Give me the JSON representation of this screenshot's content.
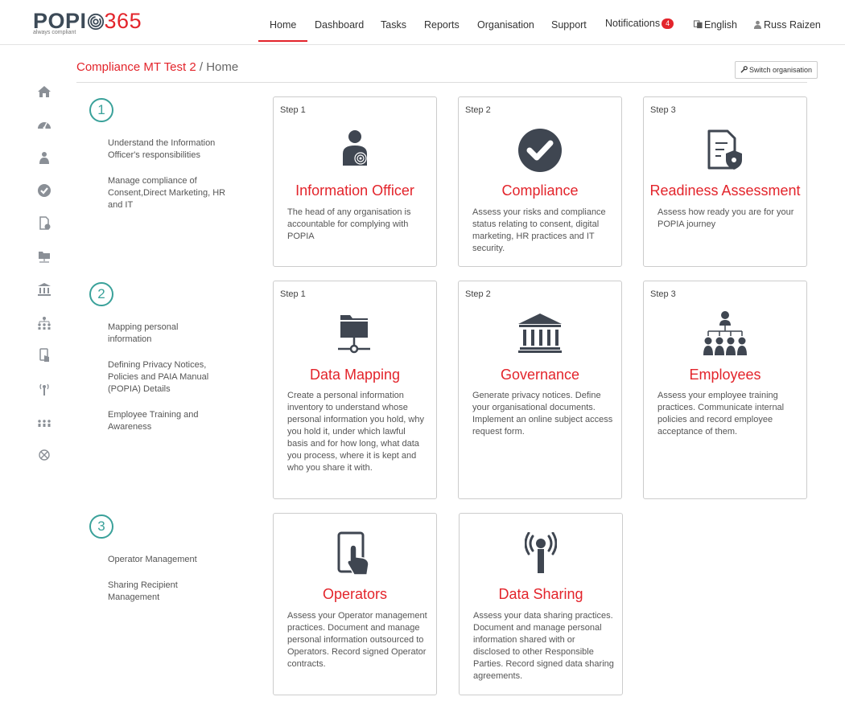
{
  "header": {
    "logo_text": "POPI",
    "logo_number": "365",
    "logo_tagline": "always compliant",
    "nav": {
      "home": "Home",
      "dashboard": "Dashboard",
      "tasks": "Tasks",
      "reports": "Reports",
      "organisation": "Organisation",
      "support": "Support",
      "notifications": "Notifications",
      "notifications_count": "4",
      "language": "English",
      "user": "Russ Raizen"
    }
  },
  "breadcrumb": {
    "organisation": "Compliance MT Test 2",
    "separator": " / ",
    "page": "Home"
  },
  "switch_button": "Switch organisation",
  "sidebar_icons": [
    "home-icon",
    "dashboard-icon",
    "information-officer-icon",
    "compliance-icon",
    "readiness-icon",
    "data-mapping-icon",
    "governance-icon",
    "employees-icon",
    "operators-icon",
    "data-sharing-icon",
    "people-icon",
    "settings-icon"
  ],
  "sections": [
    {
      "number": "1",
      "links": [
        "Understand the Information Officer's responsibilities",
        "Manage compliance of Consent,Direct Marketing, HR and IT"
      ],
      "cards": [
        {
          "step": "Step 1",
          "icon": "information-officer-icon",
          "title": "Information Officer",
          "desc": "The head of any organisation is accountable for complying with POPIA"
        },
        {
          "step": "Step 2",
          "icon": "compliance-check-icon",
          "title": "Compliance",
          "desc": "Assess your risks and compliance status relating to consent, digital marketing, HR practices and IT security."
        },
        {
          "step": "Step 3",
          "icon": "readiness-assessment-icon",
          "title": "Readiness Assessment",
          "desc": "Assess how ready you are for your POPIA journey"
        }
      ]
    },
    {
      "number": "2",
      "links": [
        "Mapping personal information",
        "Defining Privacy Notices, Policies and PAIA Manual (POPIA) Details",
        "Employee Training and Awareness"
      ],
      "cards": [
        {
          "step": "Step 1",
          "icon": "data-mapping-icon",
          "title": "Data Mapping",
          "desc": "Create a personal information inventory to understand whose personal information you hold, why you hold it, under which lawful basis and for how long, what data you process, where it is kept and who you share it with."
        },
        {
          "step": "Step 2",
          "icon": "governance-icon",
          "title": "Governance",
          "desc": "Generate privacy notices. Define your organisational documents. Implement an online subject access request form."
        },
        {
          "step": "Step 3",
          "icon": "employees-icon",
          "title": "Employees",
          "desc": "Assess your employee training practices. Communicate internal policies and record employee acceptance of them."
        }
      ]
    },
    {
      "number": "3",
      "links": [
        "Operator Management",
        "Sharing Recipient Management"
      ],
      "cards": [
        {
          "icon": "operators-icon",
          "title": "Operators",
          "desc": "Assess your Operator management practices. Document and manage personal information outsourced to Operators. Record signed Operator contracts."
        },
        {
          "icon": "data-sharing-icon",
          "title": "Data Sharing",
          "desc": "Assess your data sharing practices. Document and manage personal information shared with or disclosed to other Responsible Parties. Record signed data sharing agreements."
        }
      ]
    }
  ],
  "colors": {
    "brand_red": "#e3242b",
    "logo_dark": "#3c4a57",
    "teal": "#3aa19a",
    "icon_gray": "#3f4651"
  }
}
